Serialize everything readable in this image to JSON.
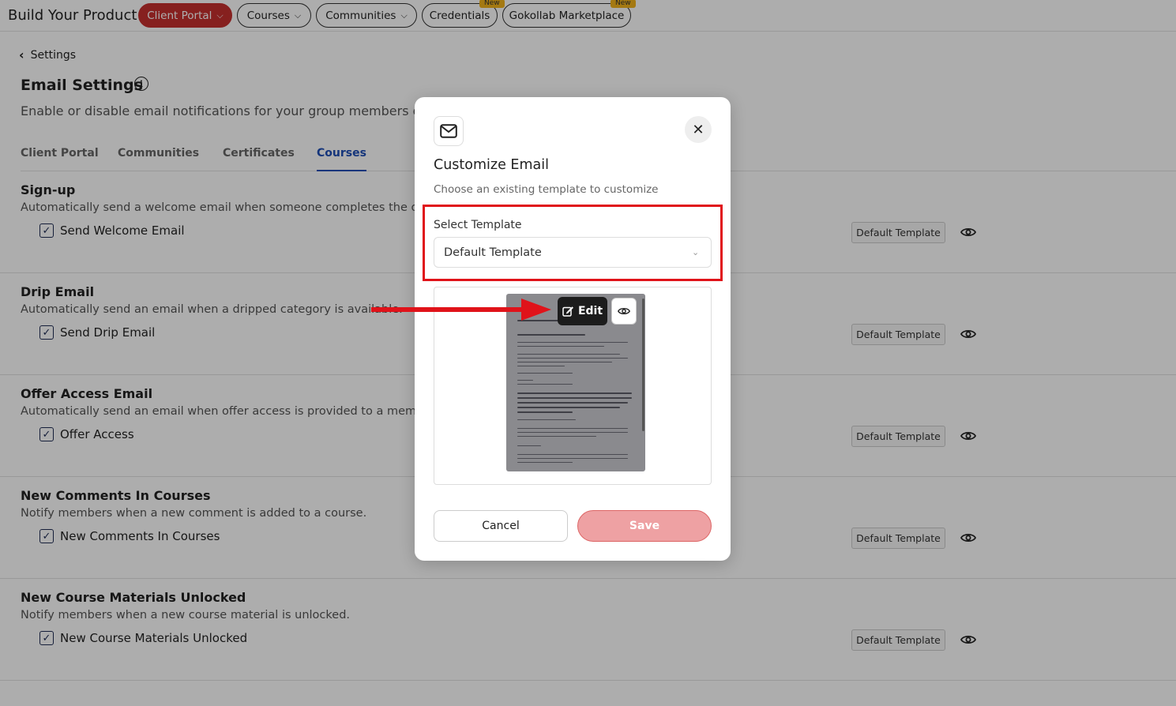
{
  "app": {
    "title": "Build Your Product"
  },
  "nav": [
    {
      "label": "Client Portal",
      "badge": ""
    },
    {
      "label": "Courses",
      "badge": ""
    },
    {
      "label": "Communities",
      "badge": ""
    },
    {
      "label": "Credentials",
      "badge": "New"
    },
    {
      "label": "Gokollab Marketplace",
      "badge": "New"
    }
  ],
  "back": {
    "label": "Settings"
  },
  "page": {
    "title": "Email Settings",
    "subtitle": "Enable or disable email notifications for your group members o"
  },
  "tabs": [
    "Client Portal",
    "Communities",
    "Certificates",
    "Courses"
  ],
  "active_tab": "Courses",
  "sections": [
    {
      "title": "Sign-up",
      "description": "Automatically send a welcome email when someone completes the off",
      "checkbox": "Send Welcome Email",
      "template": "Default Template"
    },
    {
      "title": "Drip Email",
      "description": "Automatically send an email when a dripped category is available.",
      "checkbox": "Send Drip Email",
      "template": "Default Template"
    },
    {
      "title": "Offer Access Email",
      "description": "Automatically send an email when offer access is provided to a membe",
      "checkbox": "Offer Access",
      "template": "Default Template"
    },
    {
      "title": "New Comments In Courses",
      "description": "Notify members when a new comment is added to a course.",
      "checkbox": "New Comments In Courses",
      "template": "Default Template"
    },
    {
      "title": "New Course Materials Unlocked",
      "description": "Notify members when a new course material is unlocked.",
      "checkbox": "New Course Materials Unlocked",
      "template": "Default Template"
    }
  ],
  "modal": {
    "title": "Customize Email",
    "subtitle": "Choose an existing template to customize",
    "select_label": "Select Template",
    "select_value": "Default Template",
    "edit_label": "Edit",
    "cancel_label": "Cancel",
    "save_label": "Save"
  },
  "colors": {
    "brand_red": "#c6302f",
    "accent_blue": "#1f4fb6",
    "annotation_red": "#e0131a",
    "save_pink": "#eea1a3"
  }
}
